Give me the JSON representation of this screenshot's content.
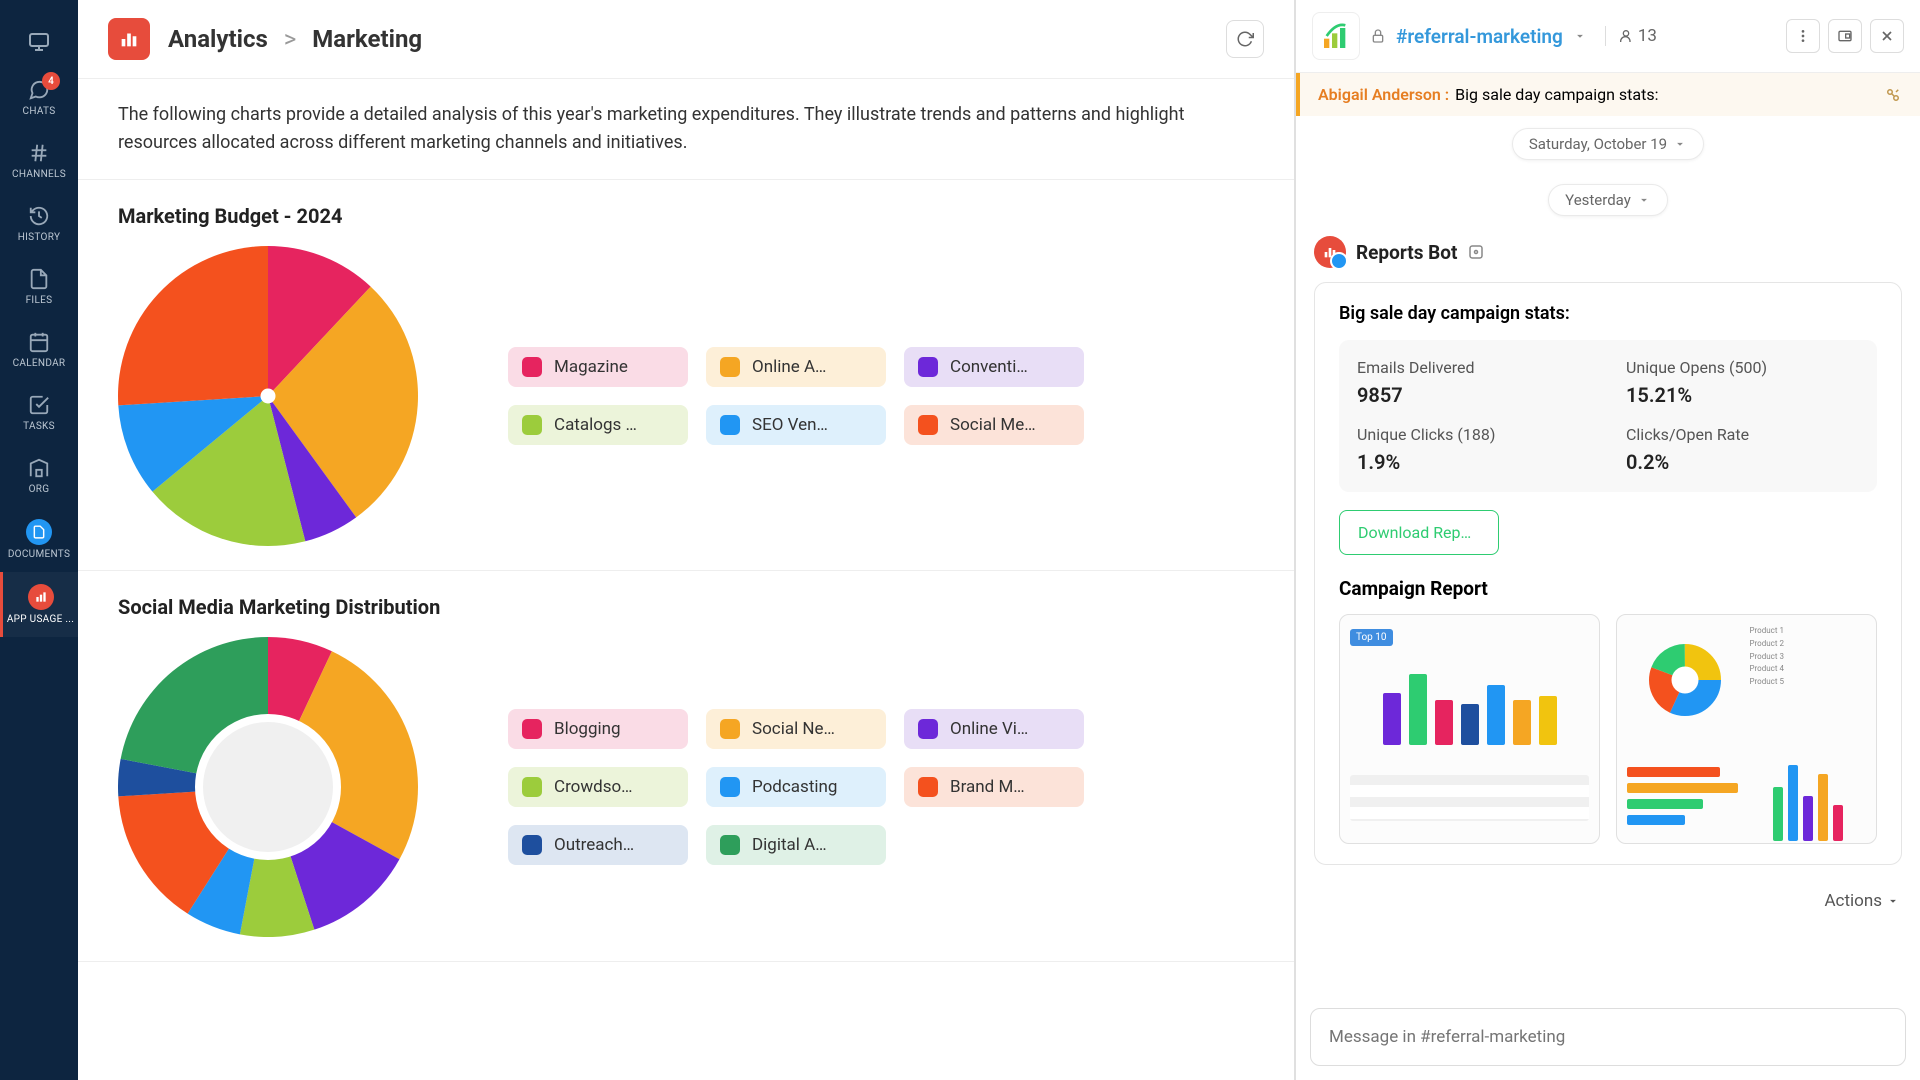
{
  "sidebar": {
    "items": [
      {
        "label": ""
      },
      {
        "label": "CHATS",
        "badge": "4"
      },
      {
        "label": "CHANNELS"
      },
      {
        "label": "HISTORY"
      },
      {
        "label": "FILES"
      },
      {
        "label": "CALENDAR"
      },
      {
        "label": "TASKS"
      },
      {
        "label": "ORG"
      },
      {
        "label": "DOCUMENTS"
      },
      {
        "label": "APP USAGE ..."
      }
    ]
  },
  "header": {
    "crumb_root": "Analytics",
    "crumb_leaf": "Marketing",
    "sep": ">"
  },
  "intro": "The following charts provide a detailed analysis of this year's marketing expenditures. They illustrate trends and patterns and highlight resources allocated across different marketing channels and initiatives.",
  "chart_data": [
    {
      "type": "pie",
      "title": "Marketing Budget - 2024",
      "series": [
        {
          "name": "Magazine",
          "value": 12,
          "color": "#e6245f"
        },
        {
          "name": "Online A…",
          "value": 28,
          "color": "#f5a623"
        },
        {
          "name": "Conventi…",
          "value": 6,
          "color": "#6d28d9"
        },
        {
          "name": "Catalogs …",
          "value": 18,
          "color": "#9ccc3c"
        },
        {
          "name": "SEO Ven…",
          "value": 10,
          "color": "#2196f3"
        },
        {
          "name": "Social Me…",
          "value": 26,
          "color": "#f4511e"
        }
      ]
    },
    {
      "type": "pie",
      "title": "Social Media Marketing Distribution",
      "donut": true,
      "series": [
        {
          "name": "Blogging",
          "value": 7,
          "color": "#e6245f"
        },
        {
          "name": "Social Ne…",
          "value": 26,
          "color": "#f5a623"
        },
        {
          "name": "Online Vi…",
          "value": 12,
          "color": "#6d28d9"
        },
        {
          "name": "Crowdso…",
          "value": 8,
          "color": "#9ccc3c"
        },
        {
          "name": "Podcasting",
          "value": 6,
          "color": "#2196f3"
        },
        {
          "name": "Brand M…",
          "value": 15,
          "color": "#f4511e"
        },
        {
          "name": "Outreach…",
          "value": 4,
          "color": "#1e4f9e"
        },
        {
          "name": "Digital A…",
          "value": 22,
          "color": "#2e9e5b"
        }
      ]
    }
  ],
  "legend_bg": {
    "#e6245f": "#fadce6",
    "#f5a623": "#fdefd8",
    "#6d28d9": "#e8def6",
    "#9ccc3c": "#ecf4da",
    "#2196f3": "#def0fc",
    "#f4511e": "#fce3d9",
    "#1e4f9e": "#dde6f2",
    "#2e9e5b": "#dff1e6"
  },
  "chat": {
    "channel": "#referral-marketing",
    "members": "13",
    "pinned": {
      "author": "Abigail Anderson :",
      "text": "Big sale day campaign stats:"
    },
    "date_pill_1": "Saturday, October 19",
    "date_pill_2": "Yesterday",
    "bot": "Reports Bot",
    "card_title": "Big sale day campaign stats:",
    "stats": [
      {
        "lab": "Emails Delivered",
        "val": "9857"
      },
      {
        "lab": "Unique Opens (500)",
        "val": "15.21%"
      },
      {
        "lab": "Unique Clicks (188)",
        "val": "1.9%"
      },
      {
        "lab": "Clicks/Open Rate",
        "val": "0.2%"
      }
    ],
    "download": "Download Repo…",
    "report_heading": "Campaign Report",
    "actions": "Actions",
    "composer_placeholder": "Message in #referral-marketing"
  }
}
